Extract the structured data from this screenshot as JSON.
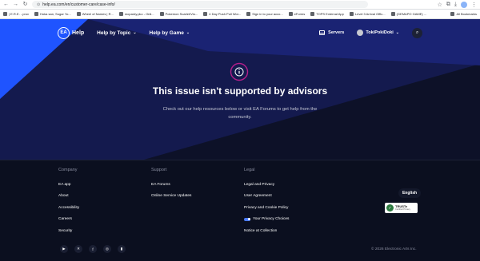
{
  "browser": {
    "url": "help.ea.com/en/customer-care/case-info/",
    "all_bookmarks_label": "All Bookmarks",
    "bookmarks": [
      "| E.R.E. - prov",
      "Hoka san, Sugar Yo...",
      "Wheel of Names | R...",
      "mopardy.pko - Onli...",
      "Pokemon Scarlet/Vio...",
      "4 Day Push Pull Wor...",
      "Sign in to your acco...",
      "eForms",
      "TOPS External App",
      "Level 3 Arrival Offic...",
      "(GEMAPO GAME) ..."
    ]
  },
  "header": {
    "logo_text": "EA",
    "help_label": "Help",
    "nav": [
      "Help by Topic",
      "Help by Game"
    ],
    "servers_label": "Servers",
    "username": "TokiPokiDoki"
  },
  "main": {
    "title": "This issue isn't supported by advisors",
    "subtitle": "Check out our help resources below or visit EA Forums to get help from the community."
  },
  "footer": {
    "company": {
      "heading": "Company",
      "links": [
        "EA app",
        "About",
        "Accessibility",
        "Careers",
        "Security"
      ]
    },
    "support": {
      "heading": "Support",
      "links": [
        "EA Forums",
        "Online Service Updates"
      ]
    },
    "legal": {
      "heading": "Legal",
      "links": [
        "Legal and Privacy",
        "User Agreement",
        "Privacy and Cookie Policy",
        "Your Privacy Choices",
        "Notice at Collection"
      ]
    },
    "language_label": "English",
    "truste": {
      "title": "TRUSTe",
      "subtitle": "Certified Privacy"
    },
    "copyright": "© 2026 Electronic Arts Inc."
  },
  "colors": {
    "brand_blue": "#1f54ff",
    "dark_navy": "#0b0f1f",
    "info_ring": "#b51f8a"
  },
  "icons": {
    "social": [
      "youtube-icon",
      "x-icon",
      "facebook-icon",
      "instagram-icon",
      "twitch-icon"
    ]
  }
}
